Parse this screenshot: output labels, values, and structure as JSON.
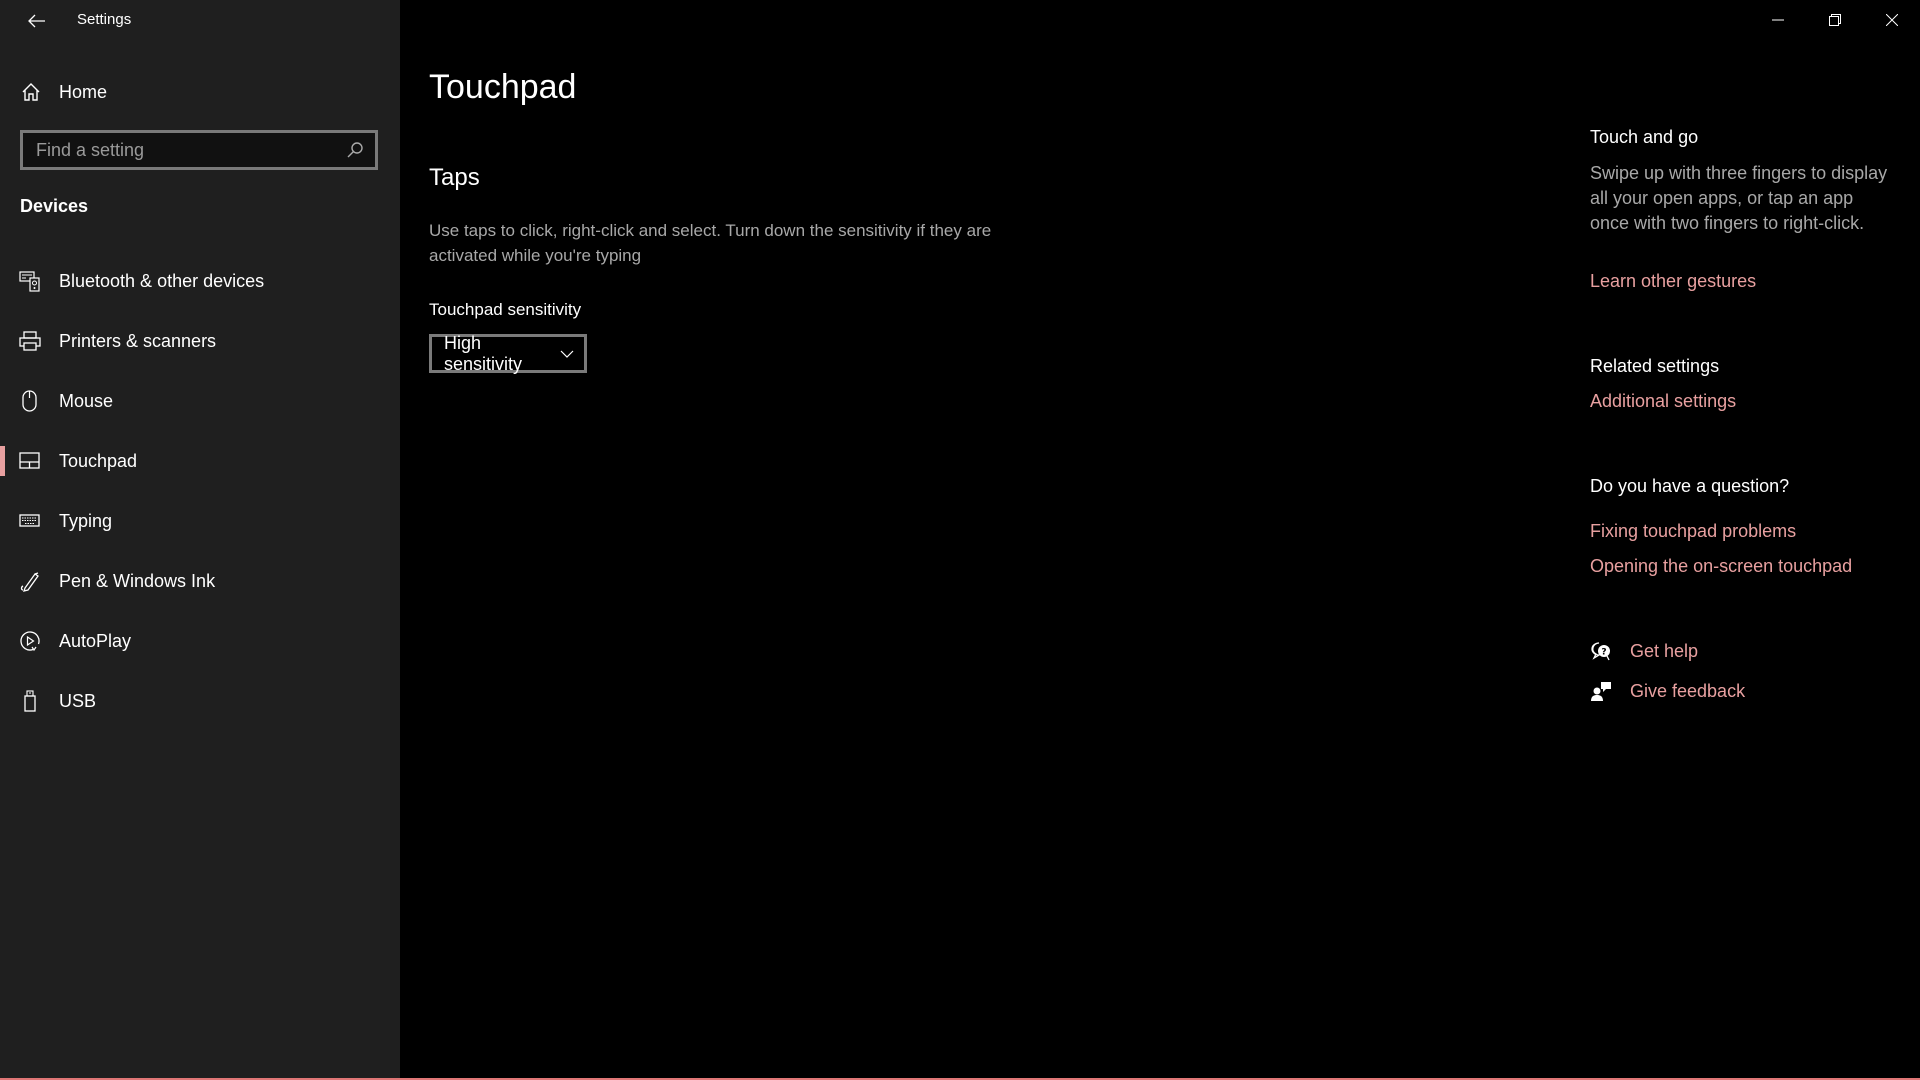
{
  "window": {
    "app_title": "Settings",
    "controls": {
      "minimize_icon": "minimize-icon",
      "maximize_icon": "restore-icon",
      "close_icon": "close-icon"
    }
  },
  "colors": {
    "accent": "#e8a0a0",
    "sidebar_bg": "#1f1f1f",
    "content_bg": "#000000",
    "bottom_border": "#e07676"
  },
  "sidebar": {
    "back_icon": "back-arrow-icon",
    "home": {
      "label": "Home",
      "icon": "home-icon"
    },
    "search": {
      "placeholder": "Find a setting",
      "value": "",
      "icon": "search-icon"
    },
    "section_heading": "Devices",
    "items": [
      {
        "label": "Bluetooth & other devices",
        "icon": "bluetooth-devices-icon",
        "selected": false
      },
      {
        "label": "Printers & scanners",
        "icon": "printer-icon",
        "selected": false
      },
      {
        "label": "Mouse",
        "icon": "mouse-icon",
        "selected": false
      },
      {
        "label": "Touchpad",
        "icon": "touchpad-icon",
        "selected": true
      },
      {
        "label": "Typing",
        "icon": "keyboard-icon",
        "selected": false
      },
      {
        "label": "Pen & Windows Ink",
        "icon": "pen-icon",
        "selected": false
      },
      {
        "label": "AutoPlay",
        "icon": "autoplay-icon",
        "selected": false
      },
      {
        "label": "USB",
        "icon": "usb-icon",
        "selected": false
      }
    ]
  },
  "main": {
    "page_title": "Touchpad",
    "taps": {
      "title": "Taps",
      "description": "Use taps to click, right-click and select. Turn down the sensitivity if they are activated while you're typing",
      "sensitivity_label": "Touchpad sensitivity",
      "sensitivity_value": "High sensitivity",
      "dropdown_icon": "chevron-down-icon"
    }
  },
  "aside": {
    "touch_and_go": {
      "title": "Touch and go",
      "text": "Swipe up with three fingers to display all your open apps, or tap an app once with two fingers to right-click.",
      "link": "Learn other gestures"
    },
    "related": {
      "title": "Related settings",
      "link": "Additional settings"
    },
    "question": {
      "title": "Do you have a question?",
      "links": [
        "Fixing touchpad problems",
        "Opening the on-screen touchpad"
      ]
    },
    "help": {
      "get_help": "Get help",
      "give_feedback": "Give feedback"
    }
  }
}
